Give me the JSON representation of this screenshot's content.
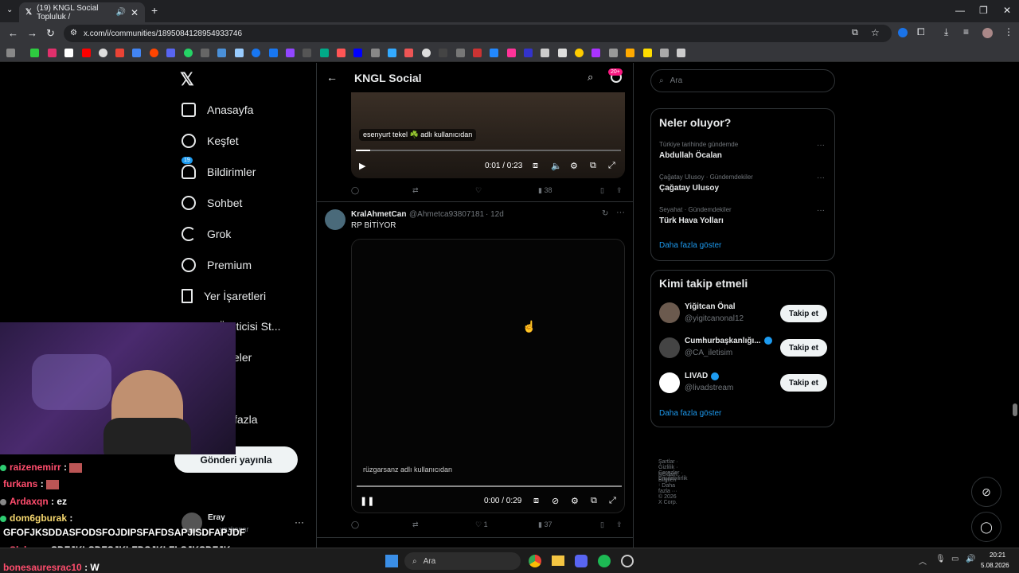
{
  "browser": {
    "tab_title": "(19) KNGL Social Topluluk /",
    "url": "x.com/i/communities/1895084128954933746"
  },
  "sidebar": {
    "items": [
      {
        "label": "Anasayfa",
        "icon": "home-icon"
      },
      {
        "label": "Keşfet",
        "icon": "search-icon"
      },
      {
        "label": "Bildirimler",
        "icon": "bell-icon",
        "badge": "19"
      },
      {
        "label": "Sohbet",
        "icon": "chat-icon"
      },
      {
        "label": "Grok",
        "icon": "grok-icon"
      },
      {
        "label": "Premium",
        "icon": "verified-icon"
      },
      {
        "label": "Yer İşaretleri",
        "icon": "bookmark-icon"
      },
      {
        "label": "Üreticisi St...",
        "icon": "lightning-icon"
      },
      {
        "label": "eler",
        "icon": "communities-icon"
      },
      {
        "label": "fazla",
        "icon": "more-icon"
      }
    ],
    "post_button": "Gönderi yayınla",
    "account_name": "Eray",
    "account_handle": "yozkenar"
  },
  "header": {
    "title": "KNGL Social",
    "badge": "20+"
  },
  "post1": {
    "overlay": "esenyurt tekel ☘️ adlı kullanıcıdan",
    "time": "0:01 / 0:23",
    "views": "38"
  },
  "post2": {
    "name": "KralAhmetCan",
    "handle": "@Ahmetca93807181",
    "age": "· 12d",
    "text": "RP BİTİYOR",
    "overlay": "rüzgarsanz adlı kullanıcıdan",
    "time": "0:00 / 0:29",
    "likes": "1",
    "views": "37"
  },
  "search": {
    "placeholder": "Ara"
  },
  "trends": {
    "title": "Neler oluyor?",
    "items": [
      {
        "meta": "Türkiye tarihinde gündemde",
        "name": "Abdullah Öcalan"
      },
      {
        "meta": "Çağatay Ulusoy · Gündemdekiler",
        "name": "Çağatay Ulusoy"
      },
      {
        "meta": "Seyahat · Gündemdekiler",
        "name": "Türk Hava Yolları"
      }
    ],
    "more": "Daha fazla göster"
  },
  "who_to_follow": {
    "title": "Kimi takip etmeli",
    "users": [
      {
        "name": "Yiğitcan Önal",
        "handle": "@yigitcanonal12",
        "button": "Takip et"
      },
      {
        "name": "Cumhurbaşkanlığı...",
        "handle": "@CA_iletisim",
        "button": "Takip et"
      },
      {
        "name": "LIVAD",
        "handle": "@livadstream",
        "button": "Takip et"
      }
    ],
    "more": "Daha fazla göster"
  },
  "footer": {
    "line1": "Şartlar · Gizlilik · Çerezler · Erişilebilirlik ·",
    "line2": "Reklam Bilgileri · Daha fazla ··· © 2026 X Corp."
  },
  "chat": [
    {
      "user": "raizenemirr",
      "msg": "",
      "color": "#ff4d6d"
    },
    {
      "user": "furkans",
      "msg": "",
      "color": "#ff4d6d"
    },
    {
      "user": "Ardaxqn",
      "msg": "ez",
      "color": "#ff4d6d"
    },
    {
      "user": "dom6gburak",
      "msg": "",
      "color": "#f5d76e"
    },
    {
      "user": "",
      "msg": "GFOFJKSDDASFODSFOJDIPSFAFDSAPJISDFAPJDF",
      "color": "#ffffff"
    },
    {
      "user": "Sleberr",
      "msg": "SDFJKLSDFSJKLFDSJKLFLŞJKSDFJK",
      "color": "#ff4d6d"
    },
    {
      "user": "bonesauresrac10",
      "msg": "W",
      "color": "#ff4d6d"
    }
  ],
  "taskbar": {
    "search": "Ara",
    "time": "20:21",
    "date": "5.08.2026"
  },
  "colors": {
    "accent": "#1d9bf0",
    "background": "#000000",
    "border": "#2f3336"
  }
}
